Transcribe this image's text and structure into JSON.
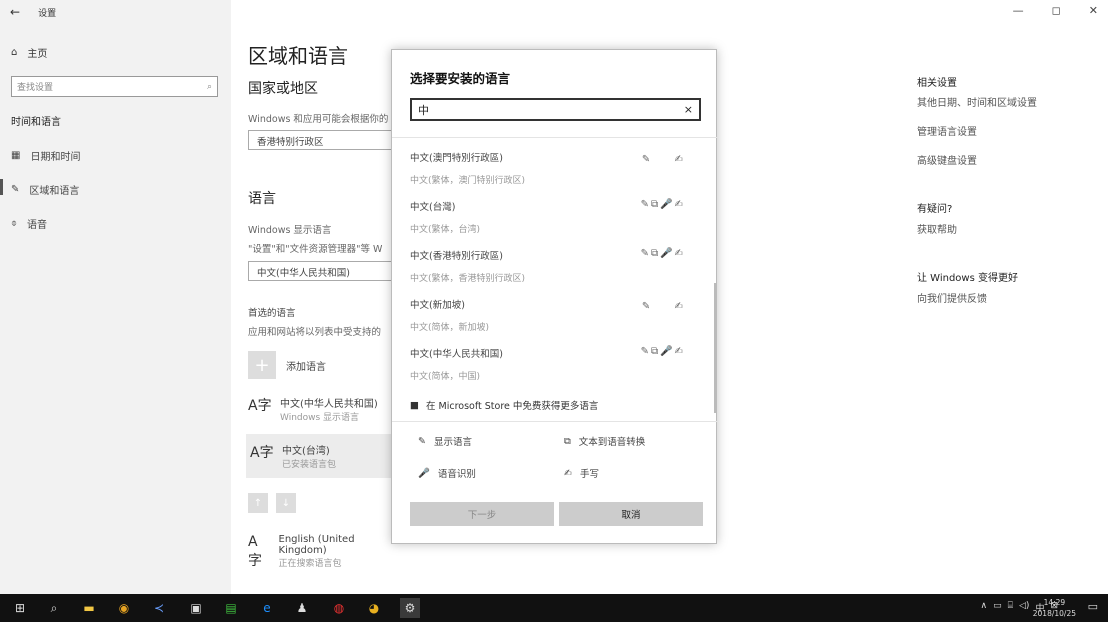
{
  "window": {
    "title": "设置",
    "back_icon": "←",
    "controls": [
      "—",
      "◻",
      "✕"
    ]
  },
  "sidebar": {
    "home": "主页",
    "search_placeholder": "查找设置",
    "section": "时间和语言",
    "items": [
      {
        "icon": "▦",
        "label": "日期和时间"
      },
      {
        "icon": "✎",
        "label": "区域和语言"
      },
      {
        "icon": "⌽",
        "label": "语音"
      }
    ]
  },
  "main": {
    "title": "区域和语言",
    "region_heading": "国家或地区",
    "region_desc": "Windows 和应用可能会根据你的",
    "region_value": "香港特别行政区",
    "language_heading": "语言",
    "display_lang_label": "Windows 显示语言",
    "display_lang_desc": "\"设置\"和\"文件资源管理器\"等 W",
    "display_lang_value": "中文(中华人民共和国)",
    "preferred_heading": "首选的语言",
    "preferred_desc": "应用和网站将以列表中受支持的",
    "add_lang": "添加语言",
    "languages": [
      {
        "glyph": "A字",
        "name": "中文(中华人民共和国)",
        "sub": "Windows 显示语言"
      },
      {
        "glyph": "A字",
        "name": "中文(台湾)",
        "sub": "已安装语言包"
      },
      {
        "glyph": "A字",
        "name": "English (United Kingdom)",
        "sub": "正在搜索语言包"
      }
    ]
  },
  "related": {
    "heading": "相关设置",
    "links": [
      "其他日期、时间和区域设置",
      "管理语言设置",
      "高级键盘设置"
    ],
    "help_heading": "有疑问?",
    "help_link": "获取帮助",
    "improve_heading": "让 Windows 变得更好",
    "improve_link": "向我们提供反馈"
  },
  "dialog": {
    "title": "选择要安装的语言",
    "search_value": "中",
    "clear_icon": "×",
    "items": [
      {
        "name": "中文(澳門特別行政區)",
        "sub": "中文(繁体，澳门特别行政区)",
        "features": "✎ 　 ✍"
      },
      {
        "name": "中文(台灣)",
        "sub": "中文(繁体，台湾)",
        "features": "✎⧉🎤✍"
      },
      {
        "name": "中文(香港特別行政區)",
        "sub": "中文(繁体，香港特别行政区)",
        "features": "✎⧉🎤✍"
      },
      {
        "name": "中文(新加坡)",
        "sub": "中文(简体，新加坡)",
        "features": "✎ 　 ✍"
      },
      {
        "name": "中文(中华人民共和国)",
        "sub": "中文(简体，中国)",
        "features": "✎⧉🎤✍"
      }
    ],
    "store_link": "在 Microsoft Store 中免费获得更多语言",
    "legend": [
      {
        "icon": "✎",
        "label": "显示语言"
      },
      {
        "icon": "⧉",
        "label": "文本到语音转换"
      },
      {
        "icon": "🎤",
        "label": "语音识别"
      },
      {
        "icon": "✍",
        "label": "手写"
      }
    ],
    "next_label": "下一步",
    "cancel_label": "取消"
  },
  "taskbar": {
    "ime": "中",
    "time": "14:29",
    "date": "2018/10/25"
  }
}
